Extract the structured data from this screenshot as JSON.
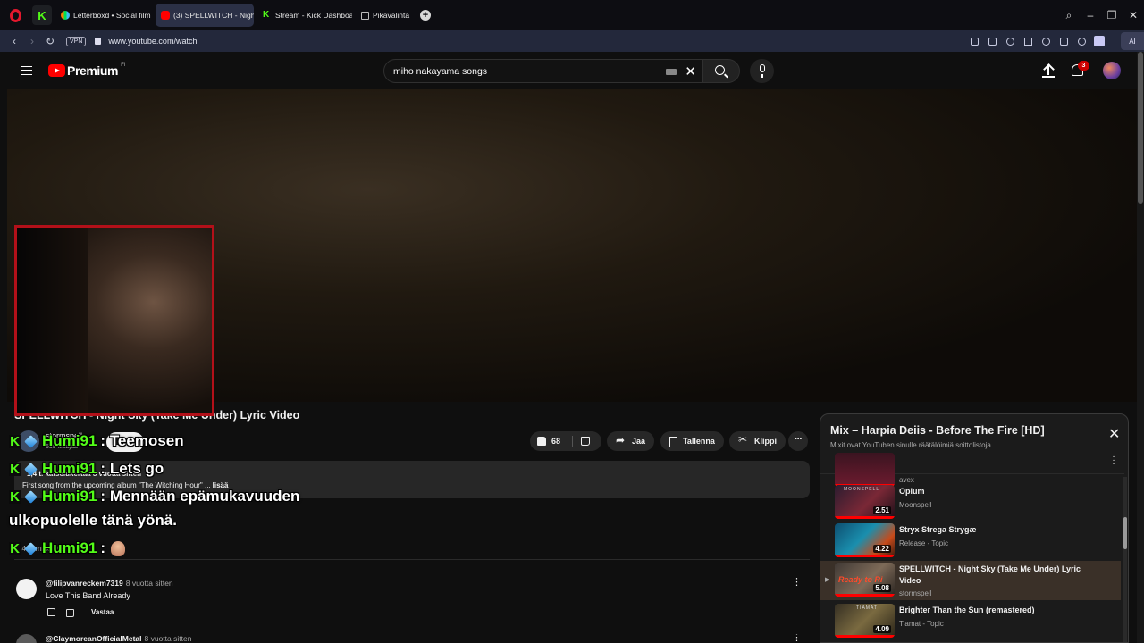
{
  "browser": {
    "tabs": [
      {
        "label": "Letterboxd • Social film d",
        "favicon": "letterboxd-icon"
      },
      {
        "label": "(3) SPELLWITCH - Night Sk",
        "favicon": "youtube-icon",
        "active": true
      },
      {
        "label": "Stream - Kick Dashboard",
        "favicon": "kick-icon"
      },
      {
        "label": "Pikavalinta",
        "favicon": "speed-dial-icon"
      }
    ],
    "url": "www.youtube.com/watch",
    "vpn_label": "VPN",
    "ai_label": "AI"
  },
  "masthead": {
    "logo_text": "Premium",
    "region": "FI",
    "search_query": "miho nakayama songs",
    "notification_count": "3"
  },
  "video": {
    "title": "SPELLWITCH - Night Sky (Take Me Under) Lyric Video",
    "channel": "stormspell",
    "subscribers": "639 tilaajaa",
    "join_label": "Liity",
    "likes": "68",
    "share_label": "Jaa",
    "save_label": "Tallenna",
    "clip_label": "Klippi",
    "description_meta": "1,4 t. katselukertaa  8 vuotta sitten",
    "description_text": "First song from the upcoming album \"The Witching Hour\" ...",
    "description_more": "lisää",
    "comments_count": "14 kommenttia"
  },
  "comments": [
    {
      "author": "@filipvanreckem7319",
      "time": "8 vuotta sitten",
      "text": "Love This Band Already",
      "reply_label": "Vastaa"
    },
    {
      "author": "@ClaymoreanOfficialMetal",
      "time": "8 vuotta sitten",
      "text": "",
      "reply_label": "Vastaa"
    }
  ],
  "chat_overlay": [
    {
      "user": "Humi91",
      "message": "Teemosen"
    },
    {
      "user": "Humi91",
      "message": "Lets go"
    },
    {
      "user": "Humi91",
      "message": "Mennään epämukavuuden",
      "continuation": "ulkopuolelle tänä yönä."
    },
    {
      "user": "Humi91",
      "message": ""
    }
  ],
  "playlist": {
    "title": "Mix – Harpia Deiis - Before The Fire [HD]",
    "subtitle": "Mixit ovat YouTuben sinulle räätälöimiä soittolistoja",
    "items": [
      {
        "title": "",
        "channel": "avex",
        "duration": "",
        "thumb": "prev"
      },
      {
        "title": "Opium",
        "channel": "Moonspell",
        "duration": "2.51",
        "thumb": "opium",
        "thumb_text": "MOONSPELL"
      },
      {
        "title": "Stryx Strega Strygæ",
        "channel": "Release - Topic",
        "duration": "4.22",
        "thumb": "stryx"
      },
      {
        "title": "SPELLWITCH - Night Sky (Take Me Under) Lyric Video",
        "channel": "stormspell",
        "duration": "5.08",
        "thumb": "spell",
        "thumb_text": "Ready to Ri",
        "current": true
      },
      {
        "title": "Brighter Than the Sun (remastered)",
        "channel": "Tiamat - Topic",
        "duration": "4.09",
        "thumb": "tiamat",
        "thumb_text": "TIAMAT"
      }
    ]
  },
  "colors": {
    "youtube_red": "#ff0000",
    "kick_green": "#53fc18",
    "background": "#0f0f0f",
    "opera_red": "#e3182d"
  }
}
